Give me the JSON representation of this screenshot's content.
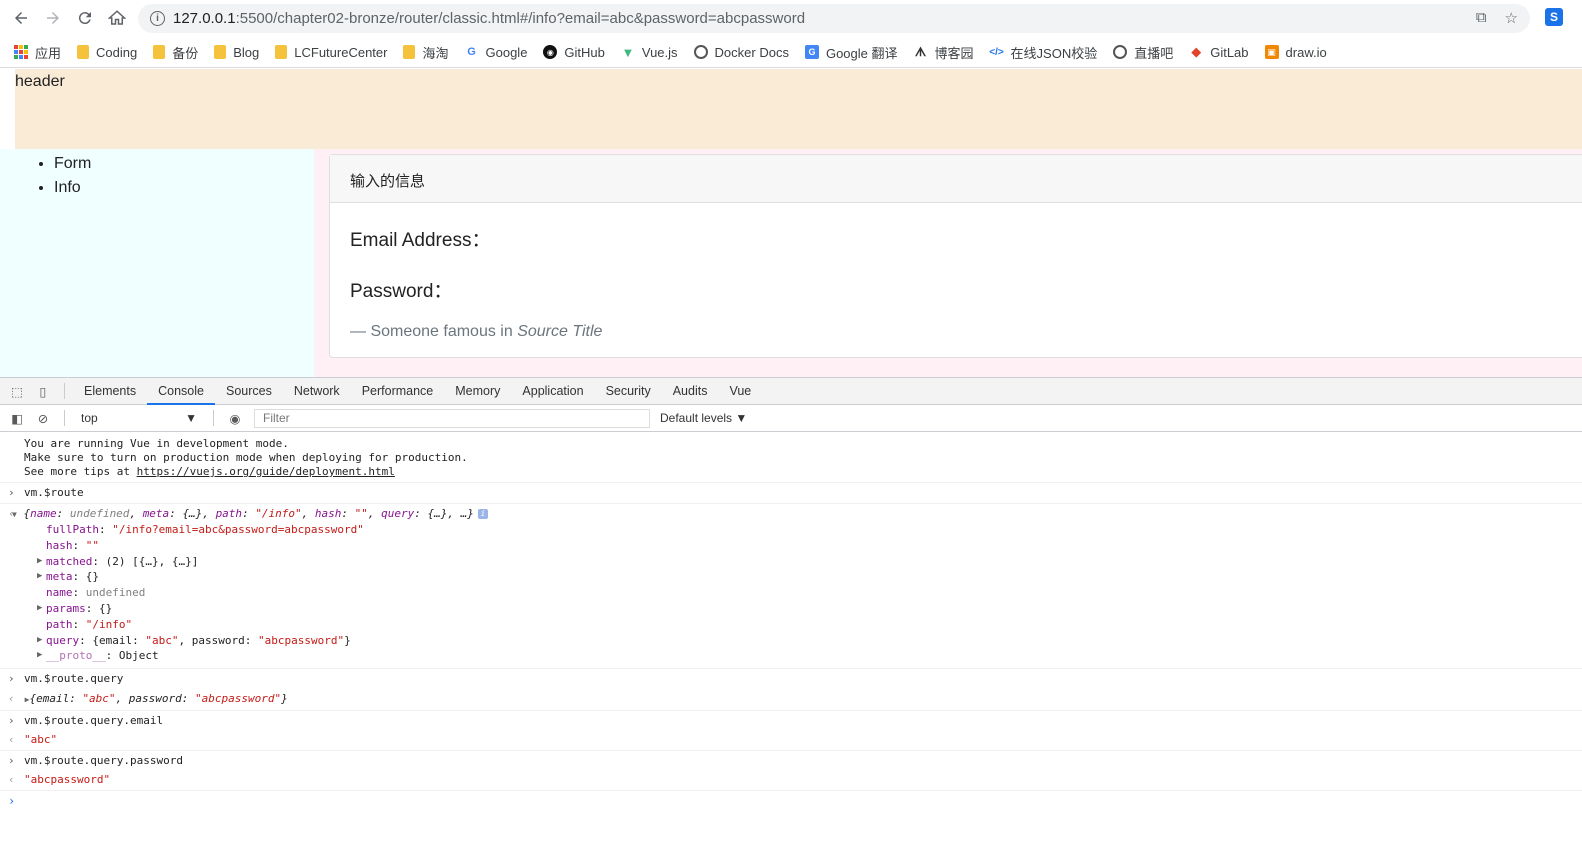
{
  "browser": {
    "url_host": "127.0.0.1",
    "url_rest": ":5500/chapter02-bronze/router/classic.html#/info?email=abc&password=abcpassword",
    "bookmarks": [
      {
        "label": "应用",
        "icon": "apps-grid-icon"
      },
      {
        "label": "Coding",
        "icon": "folder-icon"
      },
      {
        "label": "备份",
        "icon": "folder-icon"
      },
      {
        "label": "Blog",
        "icon": "folder-icon"
      },
      {
        "label": "LCFutureCenter",
        "icon": "folder-icon"
      },
      {
        "label": "海淘",
        "icon": "folder-icon"
      },
      {
        "label": "Google",
        "icon": "google-icon"
      },
      {
        "label": "GitHub",
        "icon": "github-icon"
      },
      {
        "label": "Vue.js",
        "icon": "vue-icon"
      },
      {
        "label": "Docker Docs",
        "icon": "globe-icon"
      },
      {
        "label": "Google 翻译",
        "icon": "google-translate-icon"
      },
      {
        "label": "博客园",
        "icon": "cnblogs-icon"
      },
      {
        "label": "在线JSON校验",
        "icon": "json-icon"
      },
      {
        "label": "直播吧",
        "icon": "globe-icon"
      },
      {
        "label": "GitLab",
        "icon": "gitlab-icon"
      },
      {
        "label": "draw.io",
        "icon": "drawio-icon"
      }
    ],
    "colors": {
      "folder": "#f5c33b",
      "accent": "#1a73e8"
    }
  },
  "page": {
    "header": "header",
    "nav": [
      "Form",
      "Info"
    ],
    "card": {
      "title": "输入的信息",
      "email_label": "Email Address：",
      "password_label": "Password：",
      "footer_prefix": "— Someone famous in ",
      "footer_source": "Source Title"
    },
    "colors": {
      "header_bg": "#faebd7",
      "sidebar_bg": "#f0ffff",
      "main_bg": "#fff0f5"
    }
  },
  "devtools": {
    "tabs": [
      "Elements",
      "Console",
      "Sources",
      "Network",
      "Performance",
      "Memory",
      "Application",
      "Security",
      "Audits",
      "Vue"
    ],
    "active_tab": "Console",
    "context": "top",
    "filter_placeholder": "Filter",
    "levels": "Default levels ▼",
    "console": {
      "vue_notice": [
        "You are running Vue in development mode.",
        "Make sure to turn on production mode when deploying for production.",
        "See more tips at "
      ],
      "vue_notice_link": "https://vuejs.org/guide/deployment.html",
      "cmd1": "vm.$route",
      "route_summary": {
        "open": "{",
        "name_key": "name",
        "name_val": "undefined",
        "meta_key": "meta",
        "meta_val": "{…}",
        "path_key": "path",
        "path_val": "\"/info\"",
        "hash_key": "hash",
        "hash_val": "\"\"",
        "query_key": "query",
        "query_val": "{…}",
        "close": ", …}"
      },
      "route_props": {
        "fullPath_key": "fullPath",
        "fullPath_val": "\"/info?email=abc&password=abcpassword\"",
        "hash_key": "hash",
        "hash_val": "\"\"",
        "matched_key": "matched",
        "matched_val": "(2) [{…}, {…}]",
        "meta_key": "meta",
        "meta_val": "{}",
        "name_key": "name",
        "name_val": "undefined",
        "params_key": "params",
        "params_val": "{}",
        "path_key": "path",
        "path_val": "\"/info\"",
        "query_key": "query",
        "query_open": "{email: ",
        "query_email": "\"abc\"",
        "query_mid": ", password: ",
        "query_password": "\"abcpassword\"",
        "query_close": "}",
        "proto_key": "__proto__",
        "proto_val": "Object"
      },
      "cmd2": "vm.$route.query",
      "query_result": {
        "open": "{email: ",
        "email": "\"abc\"",
        "mid": ", password: ",
        "password": "\"abcpassword\"",
        "close": "}"
      },
      "cmd3": "vm.$route.query.email",
      "result3": "\"abc\"",
      "cmd4": "vm.$route.query.password",
      "result4": "\"abcpassword\""
    }
  }
}
